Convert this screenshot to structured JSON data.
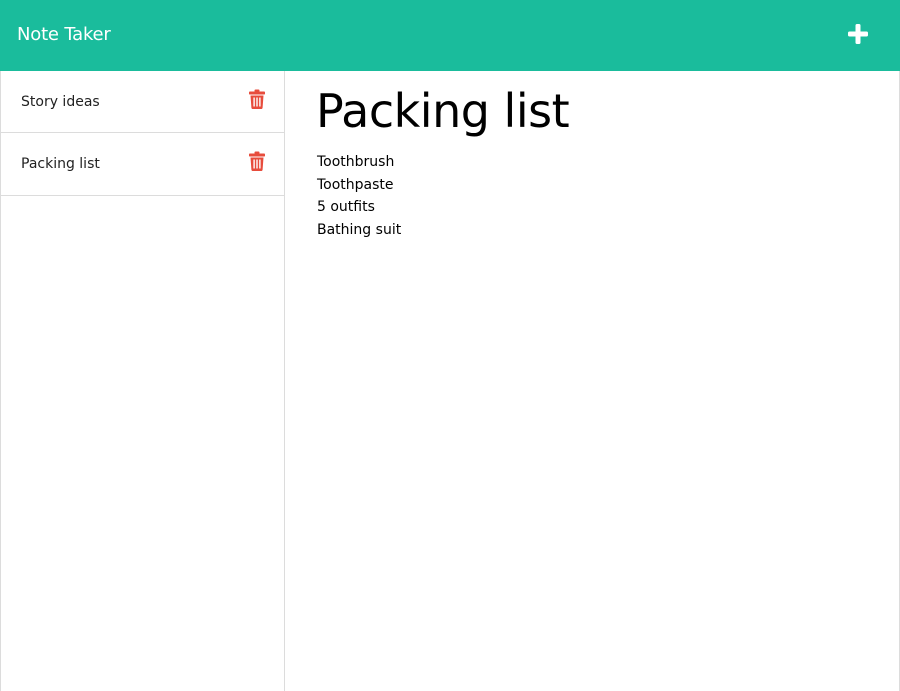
{
  "header": {
    "title": "Note Taker",
    "new_note_icon": "plus-icon"
  },
  "sidebar": {
    "items": [
      {
        "label": "Story ideas",
        "delete_icon": "trash-icon"
      },
      {
        "label": "Packing list",
        "delete_icon": "trash-icon"
      }
    ]
  },
  "note": {
    "title": "Packing list",
    "lines": [
      "Toothbrush",
      "Toothpaste",
      "5 outfits",
      "Bathing suit"
    ]
  },
  "colors": {
    "accent": "#1abc9c",
    "delete": "#e74c3c",
    "border": "#dcdcdc"
  }
}
